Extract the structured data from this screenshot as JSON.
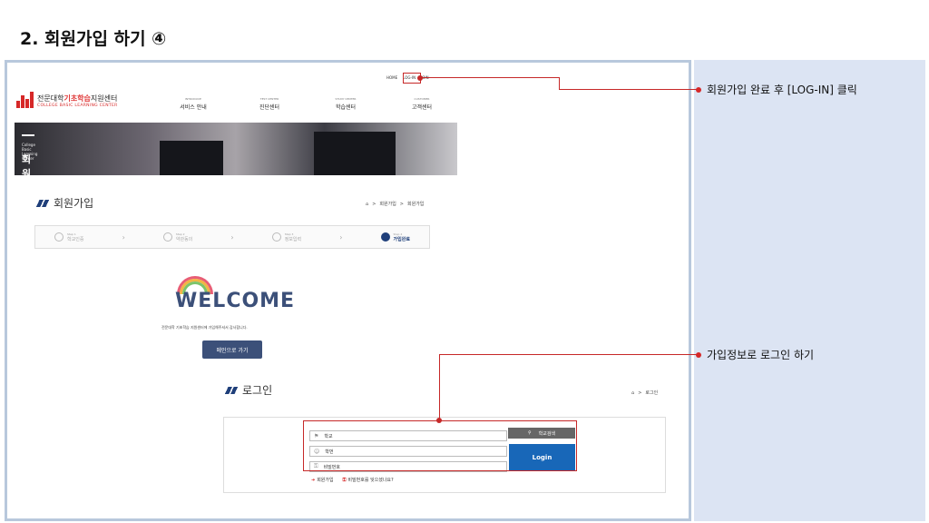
{
  "slide": {
    "title": "2. 회원가입 하기 ④",
    "callouts": [
      "회원가입 완료 후 [LOG-IN] 클릭",
      "가입정보로 로그인 하기"
    ]
  },
  "site": {
    "top_links": [
      "HOME",
      "LOG-IN",
      "JOIN"
    ],
    "logo": {
      "mark": "cBLC",
      "name_pre": "전문대학",
      "name_highlight": "기초학습",
      "name_post": "지원센터",
      "sub": "COLLEGE BASIC LEARNING CENTER"
    },
    "nav": [
      {
        "en": "INTRODUCE",
        "ko": "서비스 안내"
      },
      {
        "en": "TEST CENTER",
        "ko": "진단센터"
      },
      {
        "en": "STUDY CENTER",
        "ko": "학습센터"
      },
      {
        "en": "CUSTOMER",
        "ko": "고객센터"
      }
    ],
    "hero": {
      "subtitle": "College Basic Learning Center",
      "title": "회원가입"
    },
    "join_section": {
      "title": "회원가입",
      "breadcrumb": [
        "회원가입",
        "회원가입"
      ]
    },
    "steps": [
      {
        "small": "Step 1",
        "label": "학교인증",
        "active": false
      },
      {
        "small": "Step 2",
        "label": "약관동의",
        "active": false
      },
      {
        "small": "Step 3",
        "label": "정보입력",
        "active": false
      },
      {
        "small": "Step 4",
        "label": "가입완료",
        "active": true
      }
    ],
    "welcome": {
      "heading": "WELCOME",
      "message": "전문대학 기초학습 지원센터에 가입해주셔서 감사합니다.",
      "main_button": "메인으로 가기"
    },
    "login_section": {
      "title": "로그인",
      "breadcrumb": "로그인",
      "fields": {
        "school": "학교",
        "student_id": "학번",
        "password": "비밀번호"
      },
      "school_search_button": "학교검색",
      "login_button": "Login",
      "links": {
        "signup": "회원가입",
        "find_password": "비밀번호를 잊으셨나요?"
      }
    }
  },
  "colors": {
    "accent_red": "#c62828",
    "navy": "#3c5079",
    "login_blue": "#1867b8",
    "side_panel": "#dce4f3"
  }
}
